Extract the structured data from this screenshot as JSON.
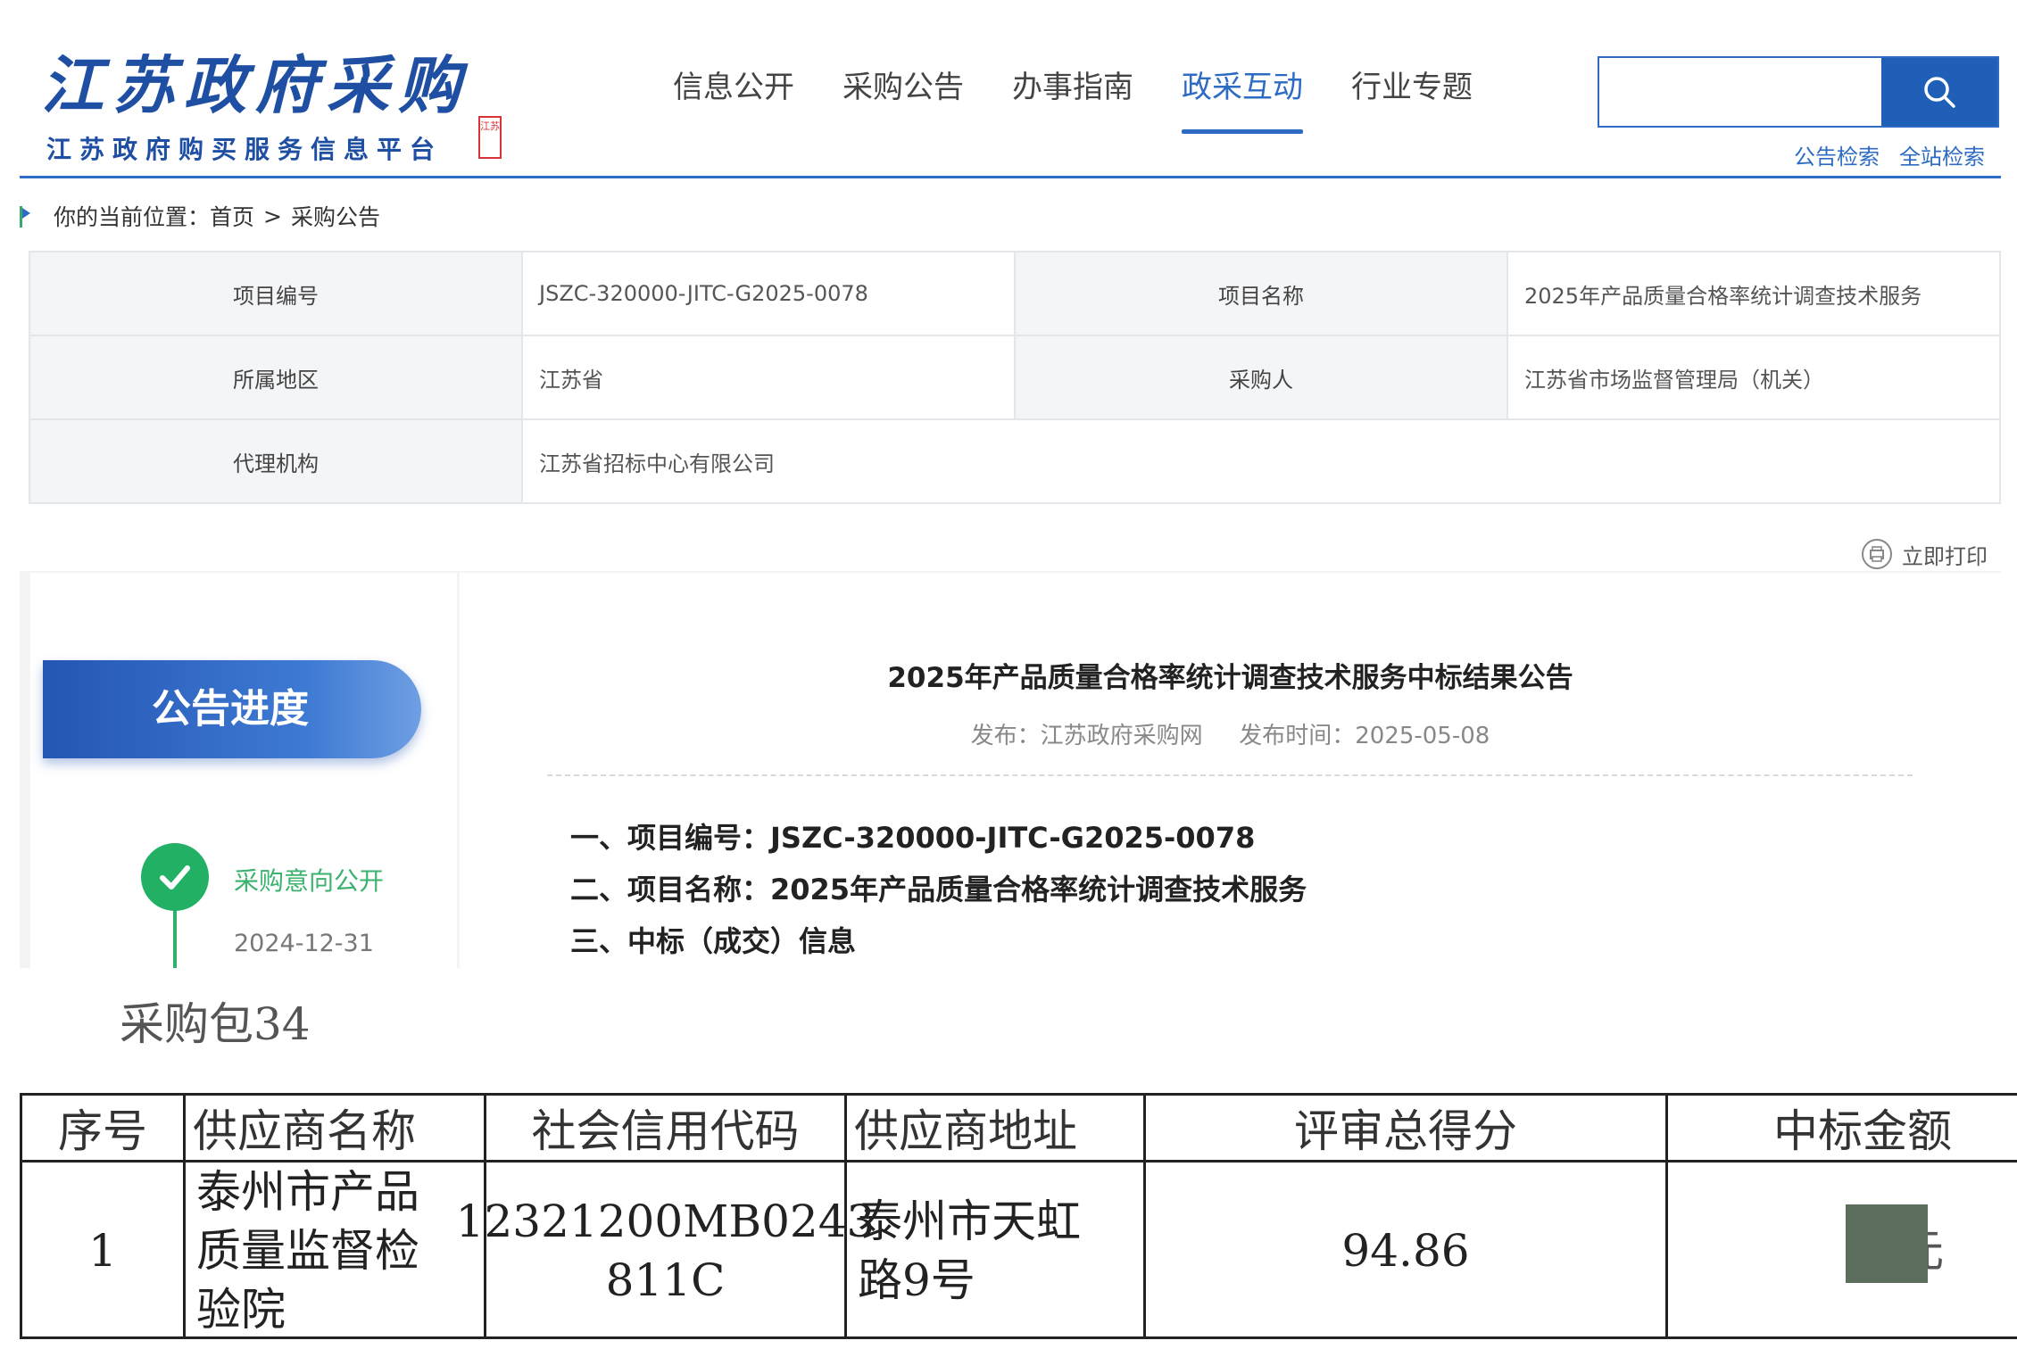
{
  "header": {
    "logo_script": "江苏政府采购",
    "logo_subtitle": "江苏政府购买服务信息平台",
    "logo_seal": "江苏"
  },
  "nav": {
    "items": [
      {
        "label": "信息公开",
        "active": false
      },
      {
        "label": "采购公告",
        "active": false
      },
      {
        "label": "办事指南",
        "active": false
      },
      {
        "label": "政采互动",
        "active": true
      },
      {
        "label": "行业专题",
        "active": false
      }
    ]
  },
  "search": {
    "value": "",
    "icon": "search-icon",
    "link_notice": "公告检索",
    "link_site": "全站检索"
  },
  "breadcrumb": {
    "prefix": "你的当前位置：",
    "home": "首页",
    "separator": ">",
    "current": "采购公告"
  },
  "info": {
    "project_no_label": "项目编号",
    "project_no": "JSZC-320000-JITC-G2025-0078",
    "project_name_label": "项目名称",
    "project_name": "2025年产品质量合格率统计调查技术服务",
    "region_label": "所属地区",
    "region": "江苏省",
    "purchaser_label": "采购人",
    "purchaser": "江苏省市场监督管理局（机关）",
    "agency_label": "代理机构",
    "agency": "江苏省招标中心有限公司"
  },
  "print_label": "立即打印",
  "sidebar": {
    "title": "公告进度",
    "step_label": "采购意向公开",
    "step_date": "2024-12-31"
  },
  "article": {
    "title": "2025年产品质量合格率统计调查技术服务中标结果公告",
    "source": "发布：江苏政府采购网",
    "time": "发布时间：2025-05-08",
    "line1": "一、项目编号：JSZC-320000-JITC-G2025-0078",
    "line2": "二、项目名称：2025年产品质量合格率统计调查技术服务",
    "line3": "三、中标（成交）信息"
  },
  "document": {
    "package": "采购包34",
    "headers": [
      "序号",
      "供应商名称",
      "社会信用代码",
      "供应商地址",
      "评审总得分",
      "中标金额"
    ],
    "row": {
      "no": "1",
      "supplier_l1": "泰州市产品",
      "supplier_l2": "质量监督检",
      "supplier_l3": "验院",
      "credit_l1": "12321200MB0243",
      "credit_l2": "811C",
      "addr_l1": "泰州市天虹",
      "addr_l2": "路9号",
      "score": "94.86",
      "amount_unit": "元"
    }
  },
  "colors": {
    "brand_blue": "#2d6bc4",
    "success_green": "#22b065"
  }
}
